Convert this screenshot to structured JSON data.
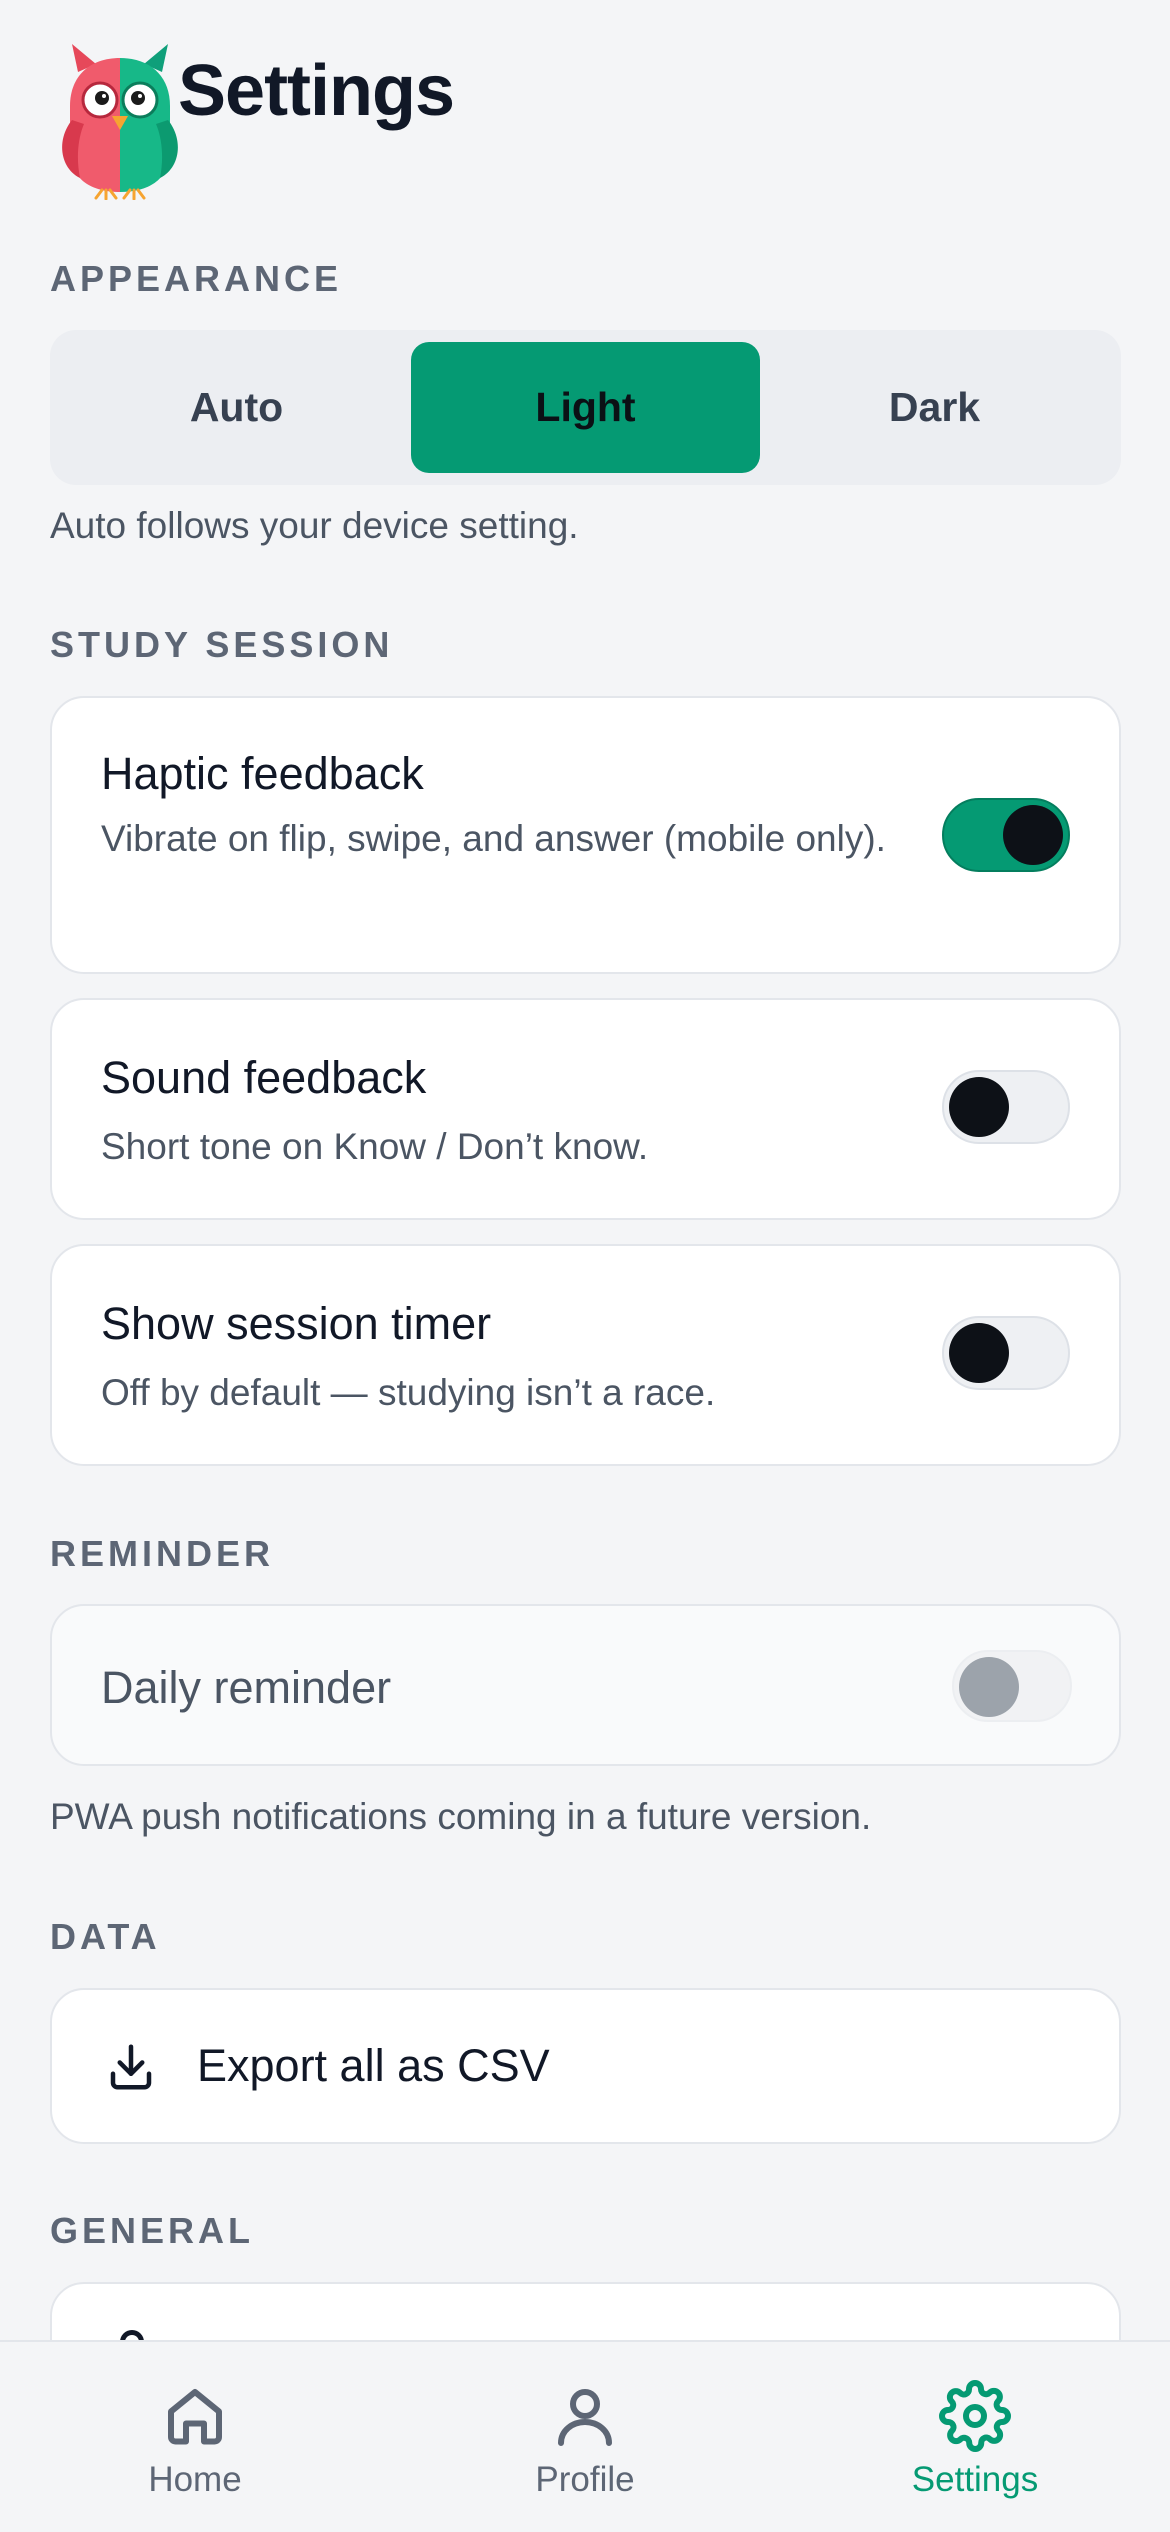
{
  "header": {
    "title": "Settings",
    "logo_icon": "owl-mascot-icon"
  },
  "appearance": {
    "label": "APPEARANCE",
    "options": [
      "Auto",
      "Light",
      "Dark"
    ],
    "selected": "Light",
    "help": "Auto follows your device setting."
  },
  "study_session": {
    "label": "STUDY SESSION",
    "haptic": {
      "title": "Haptic feedback",
      "desc": "Vibrate on flip, swipe, and answer (mobile only).",
      "enabled": true
    },
    "sound": {
      "title": "Sound feedback",
      "desc": "Short tone on Know / Don’t know.",
      "enabled": false
    },
    "timer": {
      "title": "Show session timer",
      "desc": "Off by default — studying isn’t a race.",
      "enabled": false
    }
  },
  "reminder": {
    "label": "REMINDER",
    "daily": {
      "title": "Daily reminder",
      "enabled": false,
      "disabled": true
    },
    "help": "PWA push notifications coming in a future version."
  },
  "data_section": {
    "label": "DATA",
    "export": {
      "label": "Export all as CSV",
      "icon": "download-icon"
    }
  },
  "general": {
    "label": "GENERAL"
  },
  "nav": {
    "items": [
      {
        "label": "Home",
        "icon": "home-icon"
      },
      {
        "label": "Profile",
        "icon": "user-icon"
      },
      {
        "label": "Settings",
        "icon": "gear-icon"
      }
    ],
    "active": "Settings"
  },
  "colors": {
    "accent": "#059a73",
    "background": "#f4f5f7",
    "text": "#111827",
    "muted_text": "#4b5563"
  }
}
